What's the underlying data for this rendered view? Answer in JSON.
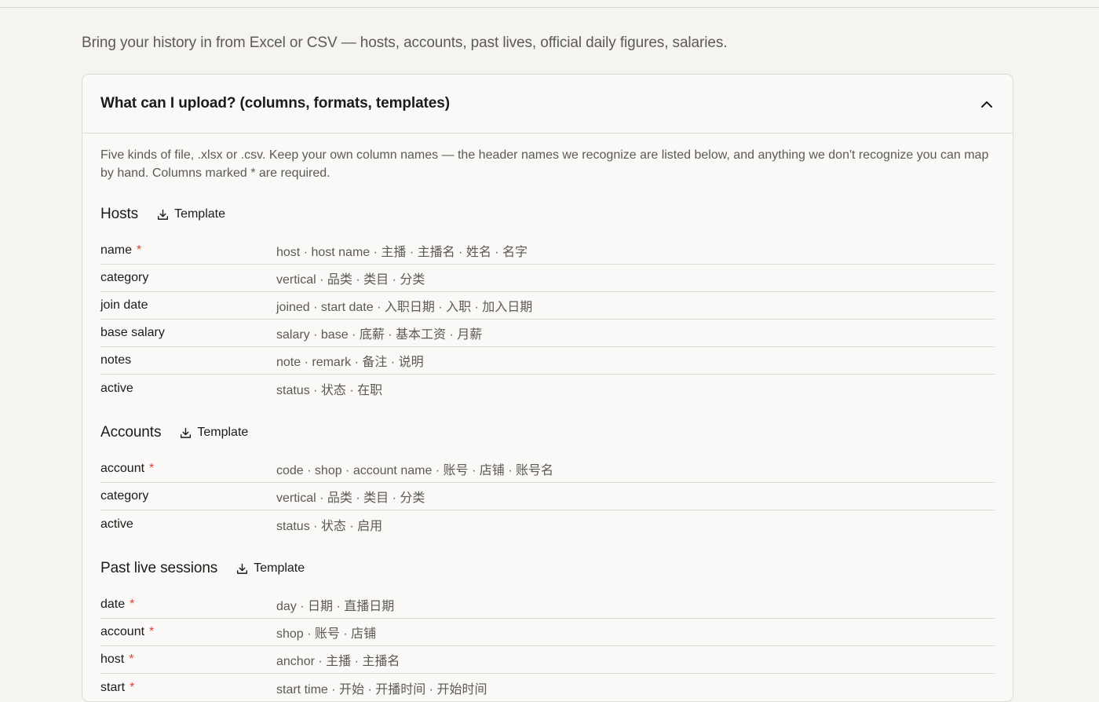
{
  "intro": "Bring your history in from Excel or CSV — hosts, accounts, past lives, official daily figures, salaries.",
  "accordion": {
    "title": "What can I upload? (columns, formats, templates)",
    "description": "Five kinds of file, .xlsx or .csv. Keep your own column names — the header names we recognize are listed below, and anything we don't recognize you can map by hand. Columns marked * are required.",
    "template_label": "Template",
    "required_mark": "*",
    "sections": [
      {
        "title": "Hosts",
        "rows": [
          {
            "name": "name",
            "required": true,
            "aliases": "host · host name · 主播 · 主播名 · 姓名 · 名字"
          },
          {
            "name": "category",
            "required": false,
            "aliases": "vertical · 品类 · 类目 · 分类"
          },
          {
            "name": "join date",
            "required": false,
            "aliases": "joined · start date · 入职日期 · 入职 · 加入日期"
          },
          {
            "name": "base salary",
            "required": false,
            "aliases": "salary · base · 底薪 · 基本工资 · 月薪"
          },
          {
            "name": "notes",
            "required": false,
            "aliases": "note · remark · 备注 · 说明"
          },
          {
            "name": "active",
            "required": false,
            "aliases": "status · 状态 · 在职"
          }
        ]
      },
      {
        "title": "Accounts",
        "rows": [
          {
            "name": "account",
            "required": true,
            "aliases": "code · shop · account name · 账号 · 店铺 · 账号名"
          },
          {
            "name": "category",
            "required": false,
            "aliases": "vertical · 品类 · 类目 · 分类"
          },
          {
            "name": "active",
            "required": false,
            "aliases": "status · 状态 · 启用"
          }
        ]
      },
      {
        "title": "Past live sessions",
        "rows": [
          {
            "name": "date",
            "required": true,
            "aliases": "day · 日期 · 直播日期"
          },
          {
            "name": "account",
            "required": true,
            "aliases": "shop · 账号 · 店铺"
          },
          {
            "name": "host",
            "required": true,
            "aliases": "anchor · 主播 · 主播名"
          },
          {
            "name": "start",
            "required": true,
            "aliases": "start time · 开始 · 开播时间 · 开始时间"
          }
        ]
      }
    ]
  }
}
